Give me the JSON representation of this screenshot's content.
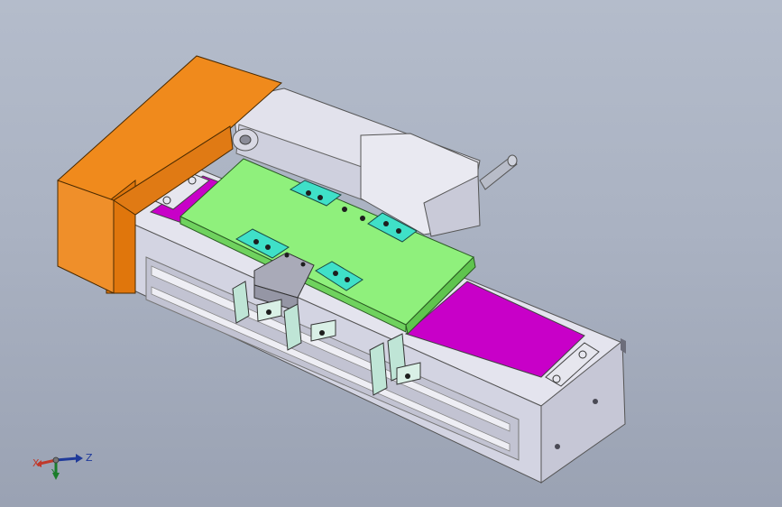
{
  "viewport": {
    "background_top": "#b4bccb",
    "background_bottom": "#9aa2b3"
  },
  "colors": {
    "motor_housing": "#f08a1c",
    "carriage_plate": "#8ff07c",
    "rail_cover": "#c800c8",
    "clamp_blocks": "#3fe0c8",
    "aluminum_body": "#d6d6e4",
    "steel_shaft": "#b8bcc8"
  },
  "triad": {
    "x_label": "X",
    "y_label": "Y",
    "z_label": "Z",
    "x_color": "#c0392b",
    "y_color": "#1a7d2b",
    "z_color": "#1f3a9a"
  }
}
